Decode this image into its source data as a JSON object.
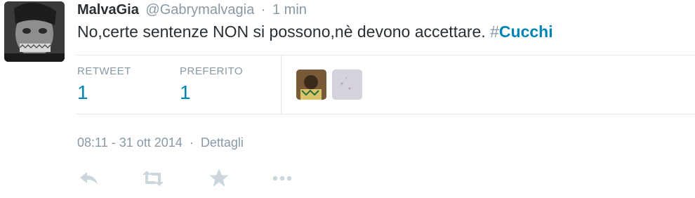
{
  "tweet": {
    "fullname": "MalvaGia",
    "username": "@Gabrymalvagia",
    "separator": "·",
    "time_ago": "1 min",
    "text_before": "No,certe sentenze NON si possono,nè devono accettare. ",
    "hashtag_symbol": "#",
    "hashtag": "Cucchi"
  },
  "stats": {
    "retweets_label": "RETWEET",
    "retweets_count": "1",
    "favorites_label": "PREFERITO",
    "favorites_count": "1"
  },
  "meta": {
    "timestamp": "08:11 - 31 ott 2014",
    "separator": "·",
    "details_link": "Dettagli"
  },
  "actions": {
    "icons": [
      "reply-icon",
      "retweet-icon",
      "favorite-star-icon",
      "more-icon"
    ]
  },
  "colors": {
    "link": "#0084b4",
    "muted": "#8899a6",
    "text": "#292f33",
    "divider": "#e1e8ed",
    "action_icon": "#ccd6dd"
  }
}
